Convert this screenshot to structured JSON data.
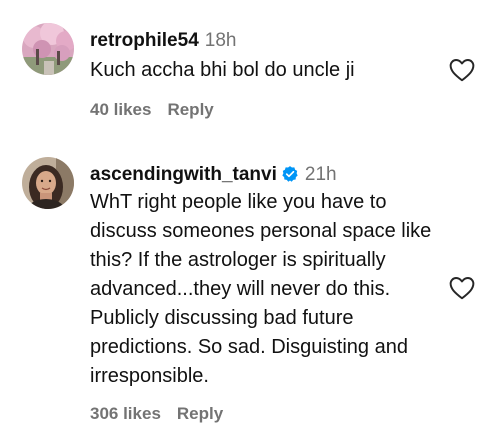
{
  "comments": [
    {
      "username": "retrophile54",
      "time": "18h",
      "text": "Kuch accha bhi bol do uncle ji",
      "likes": "40 likes",
      "reply": "Reply",
      "verified": false
    },
    {
      "username": "ascendingwith_tanvi",
      "time": "21h",
      "text": "WhT right people like you have to discuss someones personal space like this? If the astrologer is spiritually advanced...they will never do this. Publicly discussing bad future predictions. So sad. Disguisting and irresponsible.",
      "likes": "306 likes",
      "reply": "Reply",
      "verified": true
    }
  ],
  "colors": {
    "username": "#111111",
    "secondary": "#737373",
    "verified": "#0095f6"
  }
}
